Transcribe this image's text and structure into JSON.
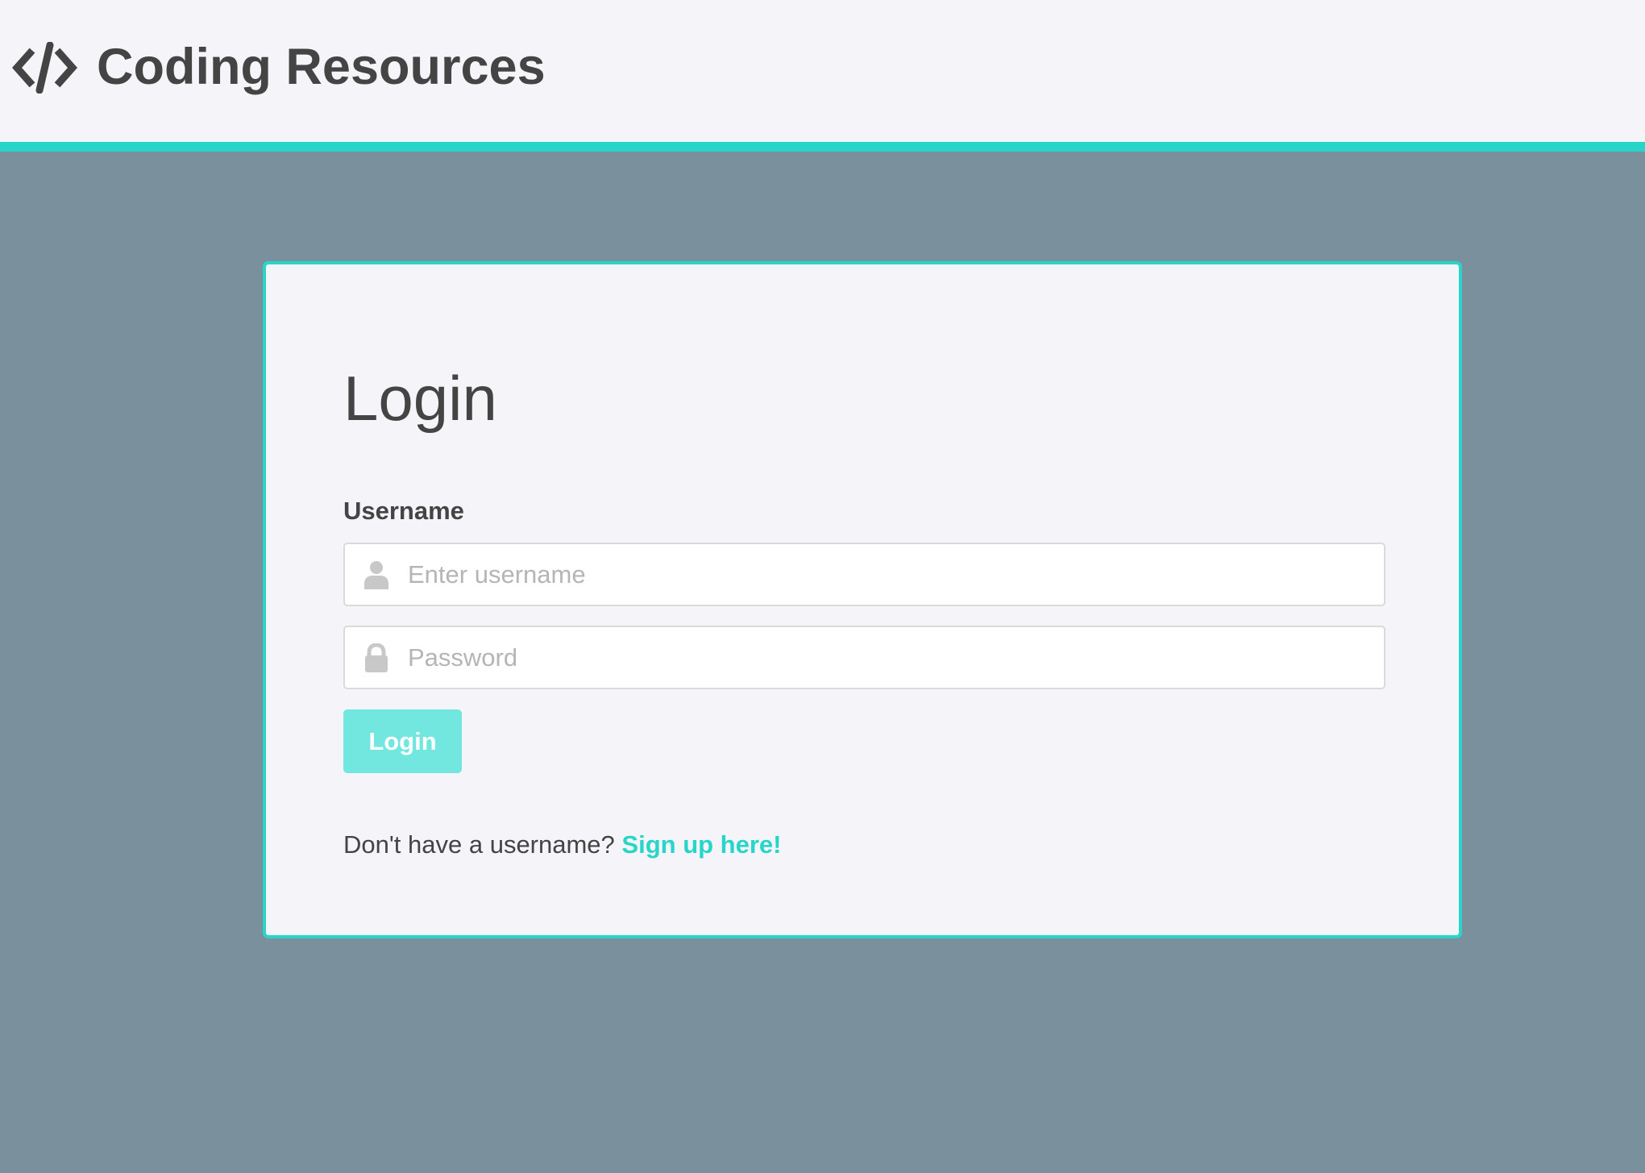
{
  "header": {
    "brand_icon": "code-icon",
    "title": "Coding Resources",
    "accent_color": "#27d6c9"
  },
  "login_card": {
    "title": "Login",
    "username_label": "Username",
    "username_placeholder": "Enter username",
    "username_icon": "user-icon",
    "username_value": "",
    "password_placeholder": "Password",
    "password_icon": "lock-icon",
    "password_value": "",
    "submit_label": "Login",
    "signup_prompt": "Don't have a username?",
    "signup_link": "Sign up here!"
  },
  "colors": {
    "page_background": "#7a919d",
    "card_background": "#f4f4f9",
    "accent": "#27d6c9",
    "button_background": "#72e7df",
    "text": "#444444"
  }
}
